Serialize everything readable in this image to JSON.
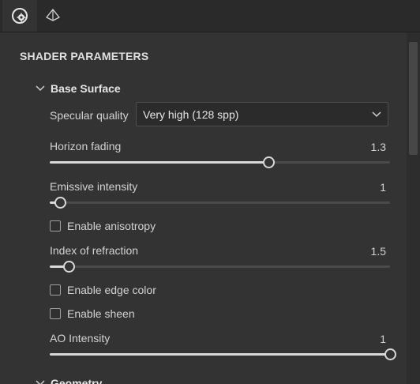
{
  "tabs": [
    {
      "icon": "material-settings-icon",
      "active": true
    },
    {
      "icon": "geometry-icon",
      "active": false
    }
  ],
  "panel": {
    "title": "SHADER PARAMETERS",
    "section": {
      "label": "Base Surface",
      "specular_quality": {
        "label": "Specular quality",
        "value": "Very high (128 spp)"
      },
      "horizon_fading": {
        "label": "Horizon fading",
        "value": "1.3",
        "fraction": 0.643
      },
      "emissive_intensity": {
        "label": "Emissive intensity",
        "value": "1",
        "fraction": 0.03
      },
      "enable_anisotropy": {
        "label": "Enable anisotropy",
        "checked": false
      },
      "index_of_refraction": {
        "label": "Index of refraction",
        "value": "1.5",
        "fraction": 0.055
      },
      "enable_edge_color": {
        "label": "Enable edge color",
        "checked": false
      },
      "enable_sheen": {
        "label": "Enable sheen",
        "checked": false
      },
      "ao_intensity": {
        "label": "AO Intensity",
        "value": "1",
        "fraction": 1.0
      }
    },
    "next_section": {
      "label": "Geometry"
    }
  },
  "colors": {
    "background": "#333333",
    "accent": "#d9d9d9",
    "track": "#4b4b4b"
  }
}
